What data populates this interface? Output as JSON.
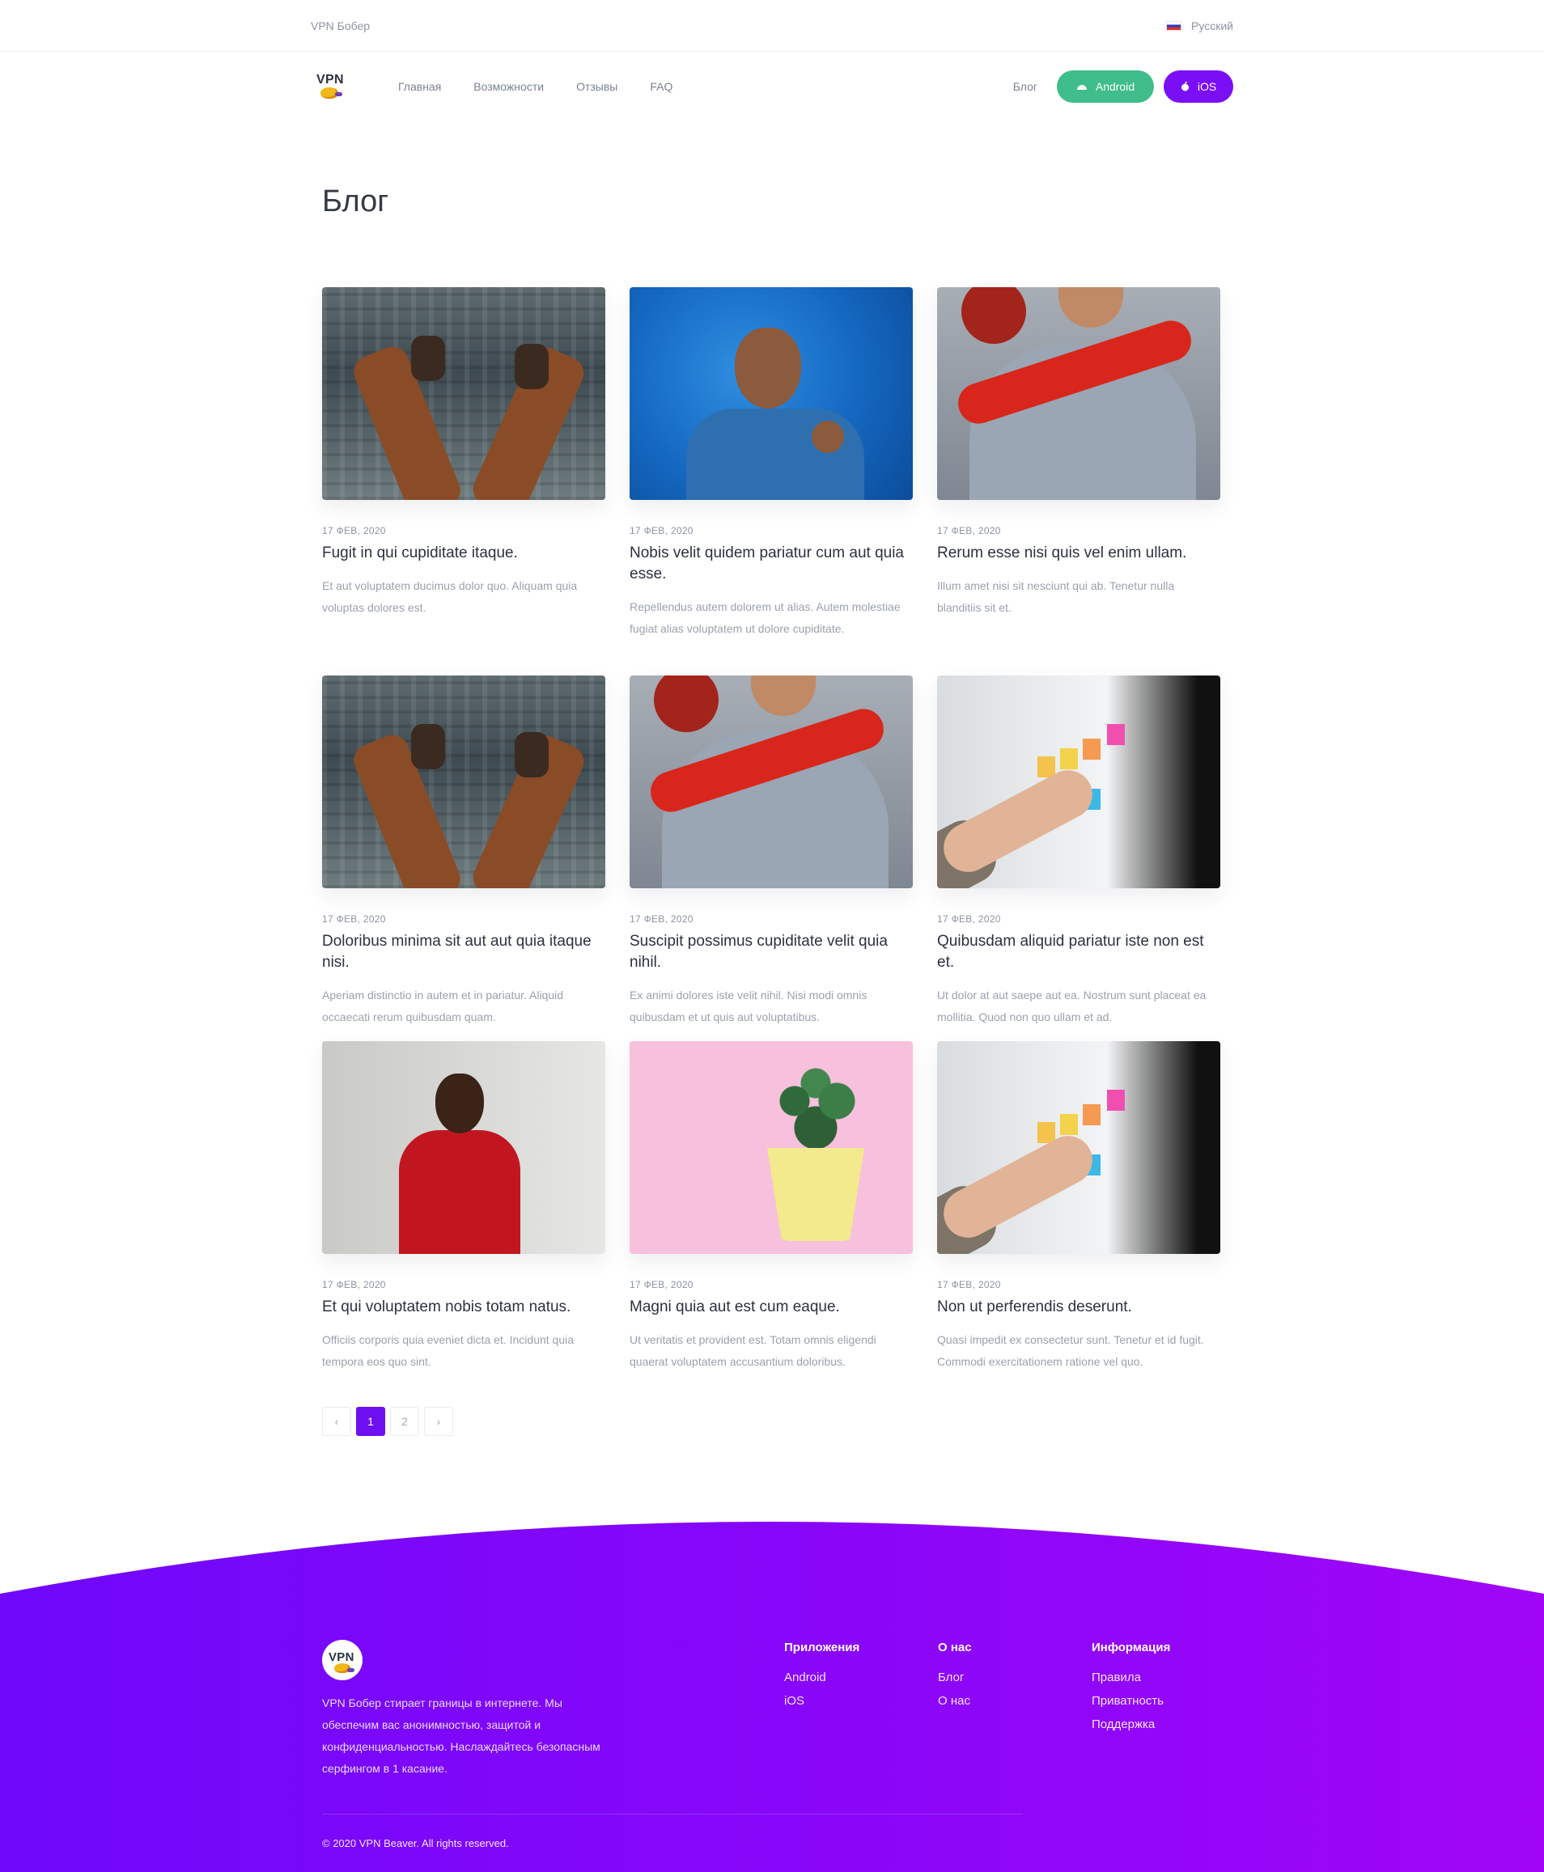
{
  "topbar": {
    "brand": "VPN Бобер",
    "language": "Русский"
  },
  "nav": {
    "logo_text": "VPN",
    "menu": [
      "Главная",
      "Возможности",
      "Отзывы",
      "FAQ"
    ],
    "blog": "Блог",
    "android": "Android",
    "ios": "iOS"
  },
  "page_title": "Блог",
  "posts": [
    {
      "date": "17 ФЕВ, 2020",
      "title": "Fugit in qui cupiditate itaque.",
      "excerpt": "Et aut voluptatem ducimus dolor quo. Aliquam quia voluptas dolores est.",
      "image": "city-feet"
    },
    {
      "date": "17 ФЕВ, 2020",
      "title": "Nobis velit quidem pariatur cum aut quia esse.",
      "excerpt": "Repellendus autem dolorem ut alias. Autem molestiae fugiat alias voluptatem ut dolore cupiditate.",
      "image": "laughing-man-blue"
    },
    {
      "date": "17 ФЕВ, 2020",
      "title": "Rerum esse nisi quis vel enim ullam.",
      "excerpt": "Illum amet nisi sit nesciunt qui ab. Tenetur nulla blanditiis sit et.",
      "image": "piggyback-couple"
    },
    {
      "date": "17 ФЕВ, 2020",
      "title": "Doloribus minima sit aut aut quia itaque nisi.",
      "excerpt": "Aperiam distinctio in autem et in pariatur. Aliquid occaecati rerum quibusdam quam.",
      "image": "city-feet"
    },
    {
      "date": "17 ФЕВ, 2020",
      "title": "Suscipit possimus cupiditate velit quia nihil.",
      "excerpt": "Ex animi dolores iste velit nihil. Nisi modi omnis quibusdam et ut quis aut voluptatibus.",
      "image": "piggyback-couple"
    },
    {
      "date": "17 ФЕВ, 2020",
      "title": "Quibusdam aliquid pariatur iste non est et.",
      "excerpt": "Ut dolor at aut saepe aut ea. Nostrum sunt placeat ea mollitia. Quod non quo ullam et ad.",
      "image": "sticky-notes-board"
    },
    {
      "date": "17 ФЕВ, 2020",
      "title": "Et qui voluptatem nobis totam natus.",
      "excerpt": "Officiis corporis quia eveniet dicta et. Incidunt quia tempora eos quo sint.",
      "image": "man-red-shirt"
    },
    {
      "date": "17 ФЕВ, 2020",
      "title": "Magni quia aut est cum eaque.",
      "excerpt": "Ut veritatis et provident est. Totam omnis eligendi quaerat voluptatem accusantium doloribus.",
      "image": "plant-pink"
    },
    {
      "date": "17 ФЕВ, 2020",
      "title": "Non ut perferendis deserunt.",
      "excerpt": "Quasi impedit ex consectetur sunt. Tenetur et id fugit. Commodi exercitationem ratione vel quo.",
      "image": "sticky-notes-board"
    }
  ],
  "pagination": {
    "prev": "‹",
    "pages": [
      "1",
      "2"
    ],
    "current": "1",
    "next": "›"
  },
  "footer": {
    "logo_text": "VPN",
    "description": "VPN Бобер стирает границы в интернете. Мы обеспечим вас анонимностью, защитой и конфиденциальностью. Наслаждайтесь безопасным серфингом в 1 касание.",
    "columns": [
      {
        "title": "Приложения",
        "links": [
          "Android",
          "iOS"
        ]
      },
      {
        "title": "О нас",
        "links": [
          "Блог",
          "О нас"
        ]
      },
      {
        "title": "Информация",
        "links": [
          "Правила",
          "Приватность",
          "Поддержка"
        ]
      }
    ],
    "copyright": "© 2020 VPN Beaver. All rights reserved."
  },
  "colors": {
    "accent_purple": "#6e0ff0",
    "android_green": "#3fbd8a",
    "footer_gradient_start": "#6f08fb",
    "footer_gradient_end": "#a005f7"
  },
  "icons": {
    "android_button": "android-icon",
    "ios_button": "apple-icon",
    "language": "russian-flag-icon"
  }
}
